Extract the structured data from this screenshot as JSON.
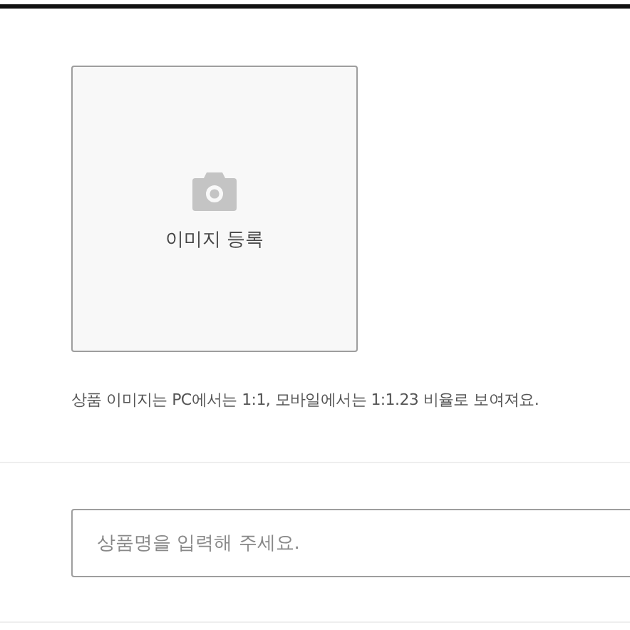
{
  "image_upload": {
    "label": "이미지 등록"
  },
  "caption": "상품 이미지는 PC에서는 1:1, 모바일에서는 1:1.23 비율로 보여져요.",
  "name_field": {
    "placeholder": "상품명을 입력해 주세요."
  }
}
